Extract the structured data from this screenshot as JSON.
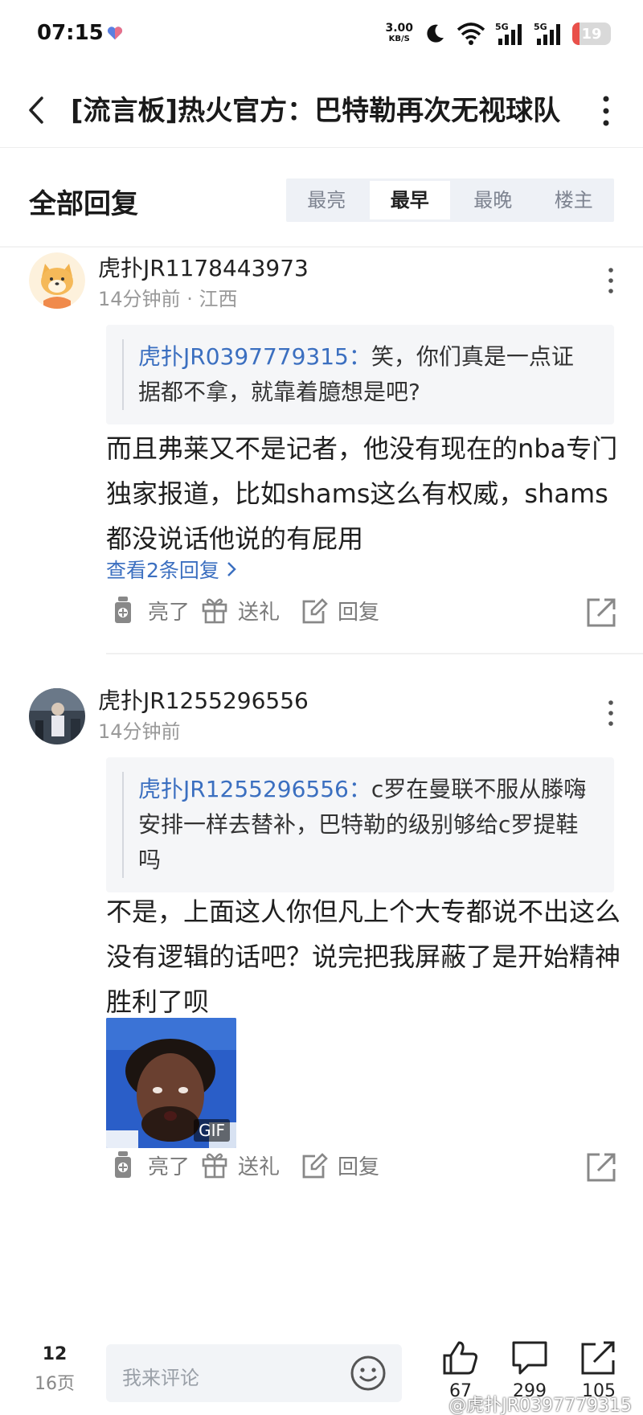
{
  "status_bar": {
    "time": "07:15",
    "net_speed": "3.00",
    "net_unit": "KB/S",
    "signal_1": "5G",
    "signal_2": "5G",
    "battery": "19",
    "battery_level": 0.19,
    "battery_color": "#e9504a"
  },
  "title_bar": {
    "title": "[流言板]热火官方：巴特勒再次无视球队"
  },
  "replies": {
    "heading": "全部回复",
    "tabs": [
      {
        "label": "最亮",
        "active": false
      },
      {
        "label": "最早",
        "active": true
      },
      {
        "label": "最晚",
        "active": false
      },
      {
        "label": "楼主",
        "active": false
      }
    ]
  },
  "comments": [
    {
      "username": "虎扑JR1178443973",
      "time": "14分钟前",
      "location": "江西",
      "quote_user": "虎扑JR0397779315：",
      "quote_text": "笑，你们真是一点证据都不拿，就靠着臆想是吧?",
      "body": "而且弗莱又不是记者，他没有现在的nba专门独家报道，比如shams这么有权威，shams都没说话他说的有屁用",
      "more_replies": "查看2条回复",
      "actions": {
        "like": "亮了",
        "gift": "送礼",
        "reply": "回复"
      }
    },
    {
      "username": "虎扑JR1255296556",
      "time": "14分钟前",
      "quote_user": "虎扑JR1255296556：",
      "quote_text": "c罗在曼联不服从滕嗨安排一样去替补，巴特勒的级别够给c罗提鞋吗",
      "body": "不是，上面这人你但凡上个大专都说不出这么没有逻辑的话吧？说完把我屏蔽了是开始精神胜利了呗",
      "gif_label": "GIF",
      "actions": {
        "like": "亮了",
        "gift": "送礼",
        "reply": "回复"
      }
    }
  ],
  "bottom_bar": {
    "page_current": "12",
    "page_total": "16页",
    "input_placeholder": "我来评论",
    "likes": "67",
    "comments": "299",
    "shares": "105",
    "watermark": "@虎扑JR0397779315"
  },
  "colors": {
    "link_blue": "#3b6fc0",
    "quote_bg": "#f5f6f8",
    "tab_bg": "#eef1f6"
  },
  "icons": [
    "back-arrow-icon",
    "more-vertical-icon",
    "heart-icon",
    "wifi-icon",
    "moon-icon",
    "signal-icon",
    "battery-icon",
    "like-bulb-icon",
    "gift-icon",
    "reply-edit-icon",
    "share-icon",
    "emoji-icon",
    "thumbs-up-icon",
    "comment-bubble-icon",
    "chevron-right-icon"
  ]
}
